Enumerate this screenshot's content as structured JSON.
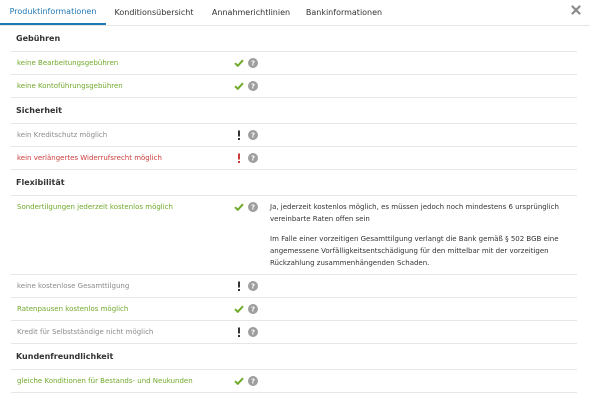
{
  "tabs": [
    {
      "label": "Produktinformationen",
      "active": true
    },
    {
      "label": "Konditionsübersicht",
      "active": false
    },
    {
      "label": "Annahmerichtlinien",
      "active": false
    },
    {
      "label": "Bankinformationen",
      "active": false
    }
  ],
  "close_icon": "close-icon",
  "colors": {
    "accent": "#1f78b4",
    "positive": "#70a92a",
    "warning": "#cc3b3b",
    "neutral": "#8a8a8a",
    "info_badge": "#9e9e9e"
  },
  "sections": [
    {
      "title": "Gebühren",
      "items": [
        {
          "label": "keine Bearbeitungsgebühren",
          "tone": "green",
          "status": "check-icon"
        },
        {
          "label": "keine Kontoführungsgebühren",
          "tone": "green",
          "status": "check-icon"
        }
      ]
    },
    {
      "title": "Sicherheit",
      "items": [
        {
          "label": "kein Kreditschutz möglich",
          "tone": "gray",
          "status": "exclamation-icon"
        },
        {
          "label": "kein verlängertes Widerrufsrecht möglich",
          "tone": "red",
          "status": "exclamation-icon"
        }
      ]
    },
    {
      "title": "Flexibilität",
      "items": [
        {
          "label": "Sondertilgungen jederzeit kostenlos möglich",
          "tone": "green",
          "status": "check-icon",
          "detail_1": "Ja, jederzeit kostenlos möglich, es müssen jedoch noch mindestens 6 ursprünglich vereinbarte Raten offen sein",
          "detail_2": "Im Falle einer vorzeitigen Gesamttilgung verlangt die Bank gemäß § 502 BGB eine angemessene Vorfälligkeitsentschädigung für den mittelbar mit der vorzeitigen Rückzahlung zusammenhängenden Schaden."
        },
        {
          "label": "keine kostenlose Gesamttilgung",
          "tone": "gray",
          "status": "exclamation-icon"
        },
        {
          "label": "Ratenpausen kostenlos möglich",
          "tone": "green",
          "status": "check-icon"
        },
        {
          "label": "Kredit für Selbstständige nicht möglich",
          "tone": "gray",
          "status": "exclamation-icon"
        }
      ]
    },
    {
      "title": "Kundenfreundlichkeit",
      "items": [
        {
          "label": "gleiche Konditionen für Bestands- und Neukunden",
          "tone": "green",
          "status": "check-icon"
        }
      ]
    }
  ]
}
